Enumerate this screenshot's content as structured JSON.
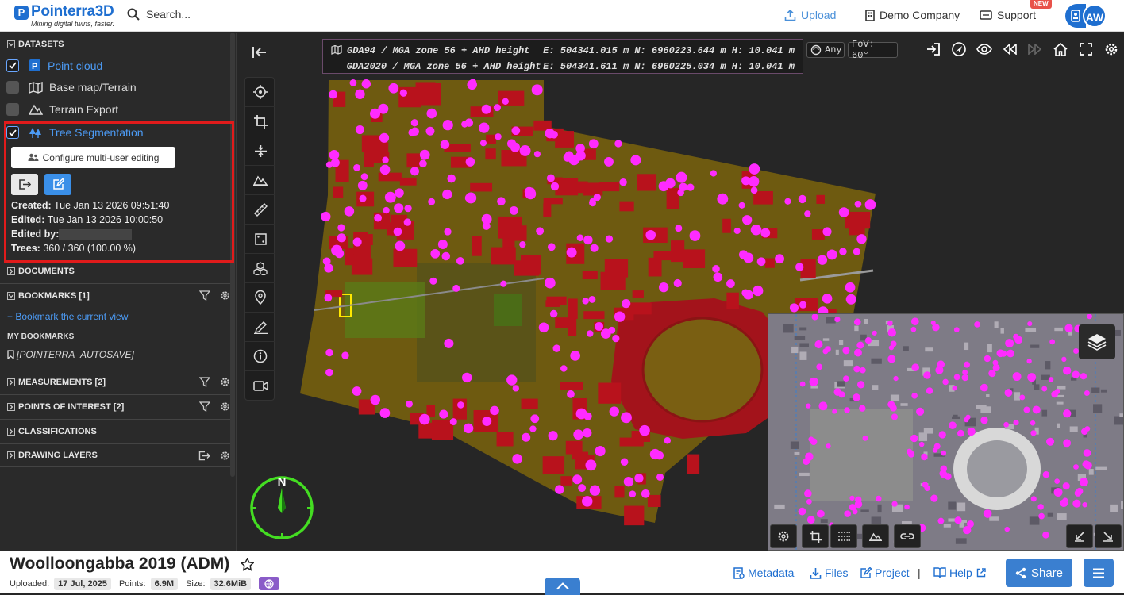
{
  "app": {
    "logo_letter": "P",
    "logo_name": "Pointerra3D",
    "tagline": "Mining digital twins, faster.",
    "search_placeholder": "Search..."
  },
  "topnav": {
    "upload": "Upload",
    "company": "Demo Company",
    "support": "Support",
    "support_badge": "NEW",
    "avatar_initials": "AW"
  },
  "sidebar": {
    "datasets_title": "DATASETS",
    "datasets": [
      {
        "label": "Point cloud",
        "checked": true
      },
      {
        "label": "Base map/Terrain",
        "checked": false
      },
      {
        "label": "Terrain Export",
        "checked": false
      },
      {
        "label": "Tree Segmentation",
        "checked": true
      }
    ],
    "configure_label": "Configure multi-user editing",
    "created_label": "Created:",
    "created_value": "Tue Jan 13 2026 09:51:40",
    "edited_label": "Edited:",
    "edited_value": "Tue Jan 13 2026 10:00:50",
    "edited_by_label": "Edited by:",
    "trees_label": "Trees:",
    "trees_value": "360 / 360 (100.00 %)",
    "documents_title": "DOCUMENTS",
    "bookmarks_title": "BOOKMARKS [1]",
    "bookmark_add": "+ Bookmark the current view",
    "my_bookmarks": "MY BOOKMARKS",
    "bookmark_item": "[POINTERRA_AUTOSAVE]",
    "measurements_title": "MEASUREMENTS [2]",
    "poi_title": "POINTS OF INTEREST [2]",
    "classifications_title": "CLASSIFICATIONS",
    "drawing_title": "DRAWING LAYERS"
  },
  "viewport": {
    "coord_row1_crs": "GDA94 / MGA zone 56 + AHD height",
    "coord_row1_vals": "E: 504341.015 m N: 6960223.644 m H: 10.041 m",
    "coord_row2_crs": "GDA2020 / MGA zone 56 + AHD height",
    "coord_row2_vals": "E: 504341.611 m N: 6960225.034 m H: 10.041 m",
    "snap_label": "Any",
    "fov_label": "FoV: 60°",
    "compass_label": "N"
  },
  "project": {
    "title": "Woolloongabba 2019 (ADM)",
    "uploaded_label": "Uploaded:",
    "uploaded_value": "17 Jul, 2025",
    "points_label": "Points:",
    "points_value": "6.9M",
    "size_label": "Size:",
    "size_value": "32.6MiB",
    "metadata": "Metadata",
    "files": "Files",
    "project_link": "Project",
    "separator": "|",
    "help": "Help",
    "share": "Share"
  },
  "colors": {
    "accent": "#1f6fd0",
    "highlight": "#e01b1b",
    "trees": "#ff2bff",
    "roofs": "#b8121c",
    "ground": "#6e5a10"
  }
}
